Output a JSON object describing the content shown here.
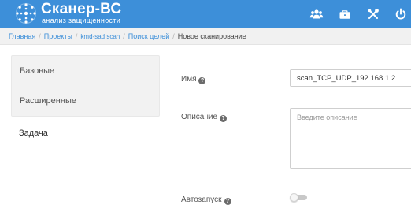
{
  "header": {
    "title": "Сканер-ВС",
    "subtitle": "анализ защищенности",
    "logo_icon": "dots-logo-icon",
    "icons": [
      "users-icon",
      "briefcase-icon",
      "tools-icon",
      "power-icon"
    ],
    "background": "#3d8fd9"
  },
  "breadcrumb": {
    "items": [
      "Главная",
      "Проекты",
      "kmd-sad scan",
      "Поиск целей"
    ],
    "current": "Новое сканирование"
  },
  "tabs": [
    {
      "label": "Базовые",
      "active": false
    },
    {
      "label": "Расширенные",
      "active": false
    },
    {
      "label": "Задача",
      "active": true
    }
  ],
  "form": {
    "name_label": "Имя",
    "name_value": "scan_TCP_UDP_192.168.1.2",
    "description_label": "Описание",
    "description_placeholder": "Введите описание",
    "autostart_label": "Автозапуск",
    "autostart_on": false,
    "help_icon": "question-circle-icon"
  }
}
